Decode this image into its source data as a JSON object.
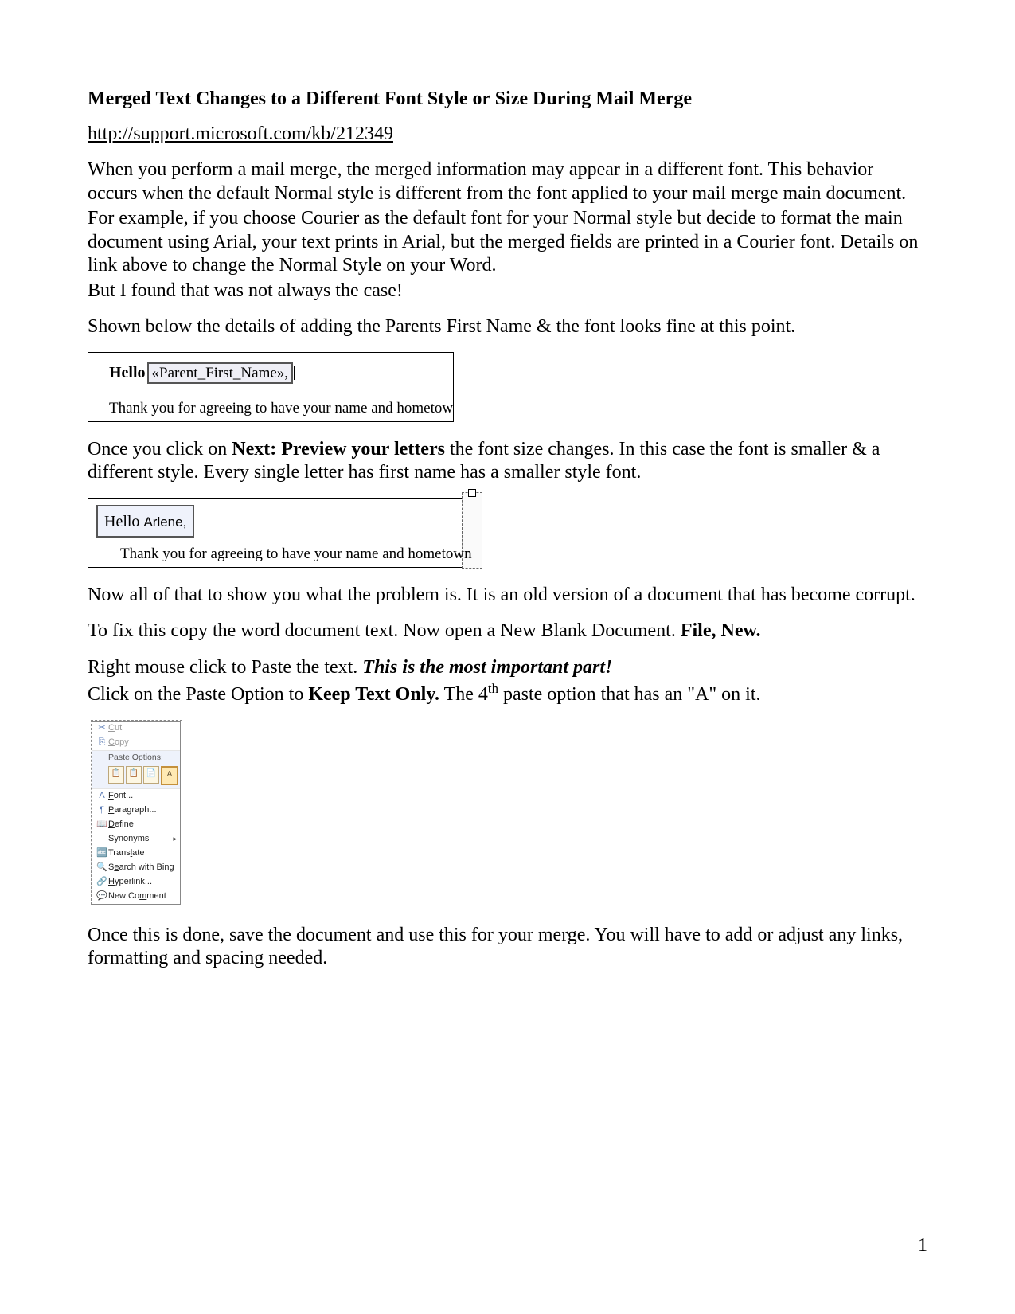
{
  "title": "Merged Text Changes to a Different Font Style or Size During Mail Merge",
  "kb_url": "http://support.microsoft.com/kb/212349",
  "p1a": "When you perform a mail merge, the merged information may appear in a different font. This behavior occurs when the default Normal style is different from the font applied to your mail merge main document.",
  "p1b": "For example, if you choose Courier as the default font for your Normal style but decide to format the main document using Arial, your text prints in Arial, but the merged fields are printed in a Courier font. Details on link above to change the Normal Style on your Word.",
  "p1c": "But I found that was not always the case!",
  "p2": "Shown below the details of adding the Parents First Name & the font looks fine at this point.",
  "word1": {
    "hello": "Hello",
    "field": "«Parent_First_Name»,",
    "thank": "Thank you for agreeing to have your name and hometown"
  },
  "p3a": "Once you click on ",
  "p3b": "Next: Preview your letters",
  "p3c": " the font size changes.  In this case the font is smaller & a different style. Every single letter has first name has a smaller style font.",
  "word2": {
    "hello": "Hello ",
    "name": "Arlene,",
    "thank": "Thank you for agreeing to have your name and hometown"
  },
  "p4": "Now all of that to show you what the problem is. It is an old version of a document that has become corrupt.",
  "p5a": "To fix this copy the word document text. Now open a New Blank Document. ",
  "p5b": "File, New.",
  "p6a": "Right mouse click to Paste the text. ",
  "p6b": "This is the most important part!",
  "p7a": "Click on the Paste Option to ",
  "p7b": "Keep Text Only.",
  "p7c": "  The 4",
  "p7sup": "th",
  "p7d": " paste option that has an \"A\" on it.",
  "context_menu": {
    "cut_icon": "✂",
    "cut": "Cut",
    "copy_icon": "⎘",
    "copy": "Copy",
    "paste_icon": "📋",
    "paste_section": "Paste Options:",
    "paste_btns": [
      "📋",
      "📋",
      "📄",
      "A"
    ],
    "font_icon": "A",
    "font": "Font...",
    "para_icon": "¶",
    "paragraph": "Paragraph...",
    "define_icon": "📖",
    "define": "Define",
    "synonyms": "Synonyms",
    "translate_icon": "🔤",
    "translate": "Translate",
    "search_icon": "🔍",
    "search": "Search with Bing",
    "hyperlink_icon": "🔗",
    "hyperlink": "Hyperlink...",
    "comment_icon": "💬",
    "comment": "New Comment"
  },
  "p8": "Once this is done, save the document and use this for your merge. You will have to add or adjust any links, formatting and spacing needed.",
  "page_number": "1"
}
